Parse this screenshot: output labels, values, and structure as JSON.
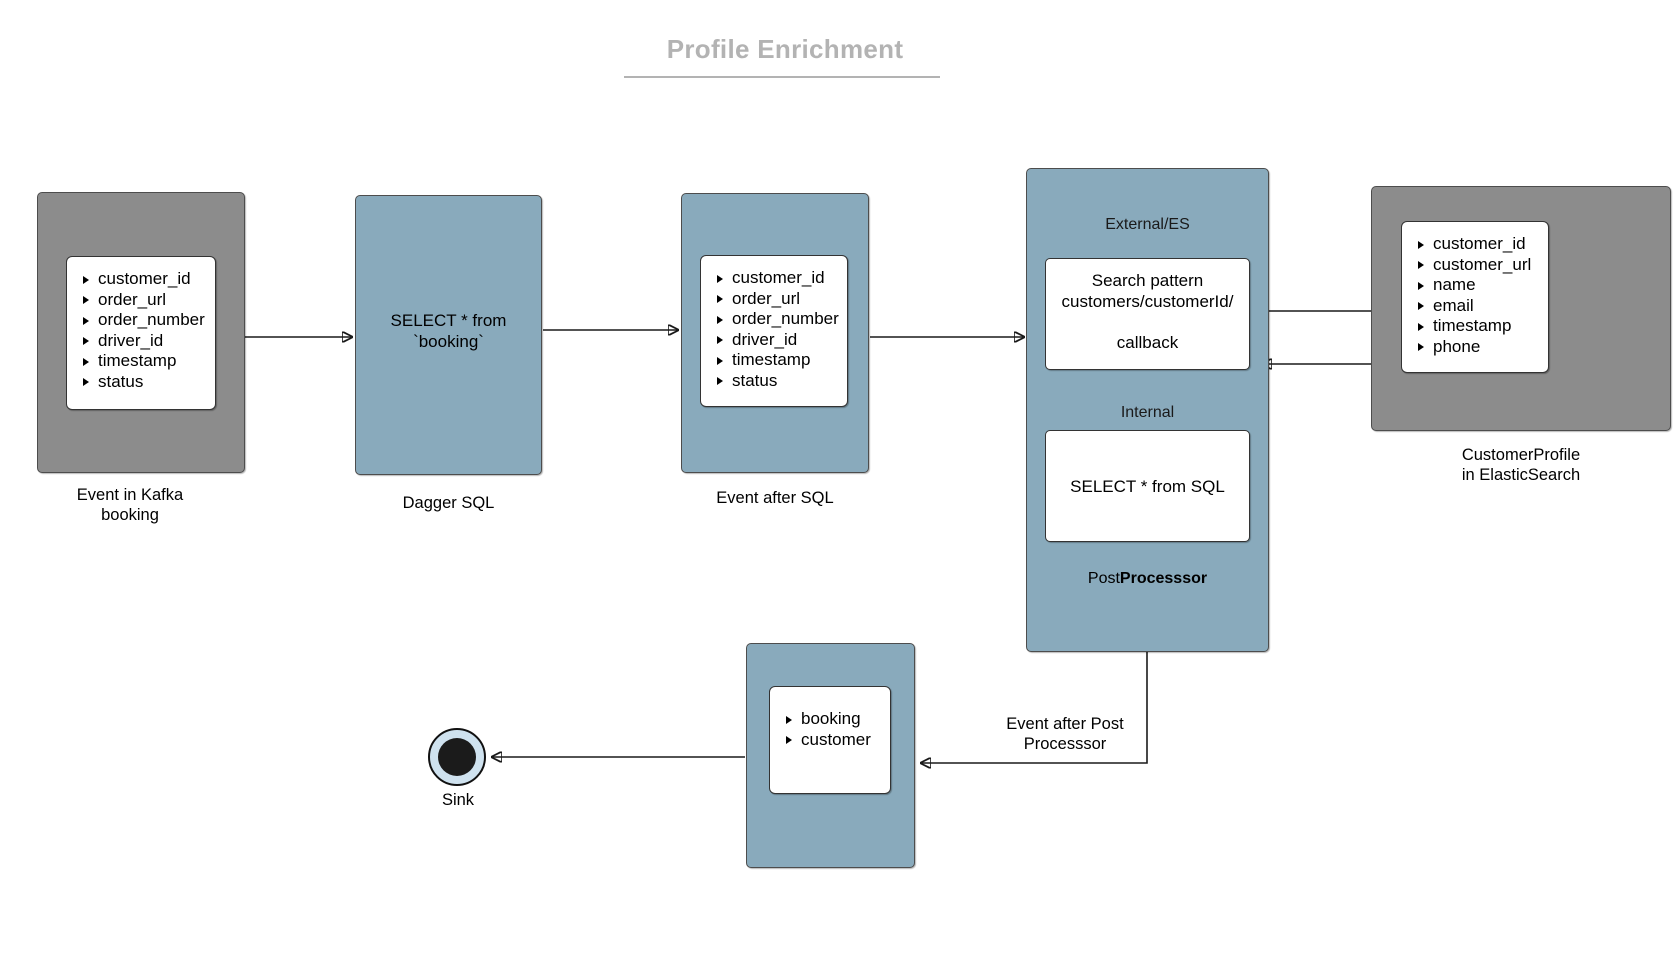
{
  "title": "Profile Enrichment",
  "kafka_event": {
    "caption_line1": "Event in Kafka",
    "caption_line2": "booking",
    "fields": [
      "customer_id",
      "order_url",
      "order_number",
      "driver_id",
      "timestamp",
      "status"
    ]
  },
  "dagger_sql": {
    "text_line1": "SELECT * from",
    "text_line2": "`booking`",
    "caption": "Dagger SQL"
  },
  "event_after_sql": {
    "caption": "Event after SQL",
    "fields": [
      "customer_id",
      "order_url",
      "order_number",
      "driver_id",
      "timestamp",
      "status"
    ]
  },
  "post_processor": {
    "external_label": "External/ES",
    "search_line1": "Search pattern",
    "search_line2": "customers/customerId/",
    "search_line3": "callback",
    "internal_label": "Internal",
    "internal_text": "SELECT * from SQL",
    "label_prefix": "Post",
    "label_suffix": "Processsor"
  },
  "customer_profile": {
    "caption_line1": "CustomerProfile",
    "caption_line2": "in ElasticSearch",
    "fields": [
      "customer_id",
      "customer_url",
      "name",
      "email",
      "timestamp",
      "phone"
    ]
  },
  "final_event": {
    "fields": [
      "booking",
      "customer"
    ],
    "edge_label_line1": "Event after Post",
    "edge_label_line2": "Processsor"
  },
  "sink": {
    "caption": "Sink"
  },
  "colors": {
    "gray_box": "#8c8c8c",
    "blue_box": "#89aabc",
    "white_box": "#ffffff",
    "title": "#b3b3b3",
    "stroke": "#1a1a1a"
  }
}
